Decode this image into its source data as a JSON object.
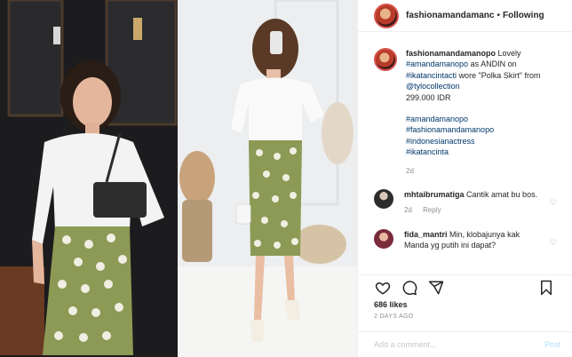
{
  "header": {
    "username": "fashionamandamanc",
    "separator": "•",
    "follow_label": "Following"
  },
  "post": {
    "author": "fashionamandamanopo",
    "caption_parts": [
      "Lovely",
      "#amandamanopo",
      "as ANDIN on",
      "#ikatancintacti",
      "wore \"Polka Skirt\" from",
      "@tylocollection"
    ],
    "price": "299.000 IDR",
    "tags": [
      "#amandamanopo",
      "#fashionamandamanopo",
      "#indonesianactress",
      "#ikatancinta"
    ],
    "time": "2d"
  },
  "comments": [
    {
      "author": "mhtaibrumatiga",
      "text": "Cantik amat bu bos.",
      "time": "2d",
      "reply": "Reply"
    },
    {
      "author": "fida_mantri",
      "text": "Min, klobajunya kak Manda yg putih ini dapat?"
    }
  ],
  "icons": [
    "heart-icon",
    "comment-icon",
    "share-icon",
    "bookmark-icon"
  ],
  "likes": "686 likes",
  "posted_ago": "2 DAYS AGO",
  "add_comment": {
    "placeholder": "Add a comment...",
    "post_label": "Post"
  },
  "colors": {
    "link": "#00376b",
    "muted": "#8e8e8e",
    "post_btn": "#b2dffc",
    "skirt": "#8c9a55"
  }
}
